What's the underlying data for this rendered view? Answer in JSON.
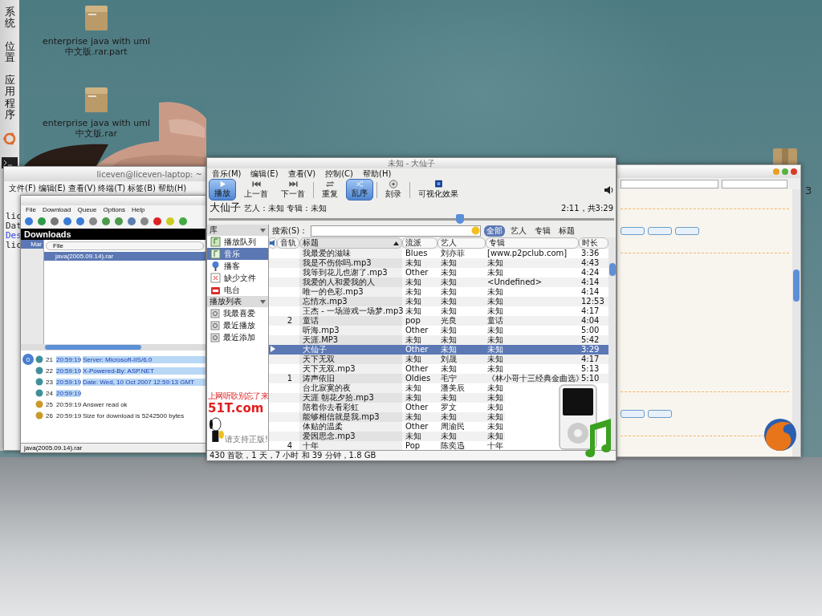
{
  "panel_menus": [
    {
      "label": "系统"
    },
    {
      "label": "位置"
    },
    {
      "label": "应用程序"
    }
  ],
  "desktop_icons": [
    {
      "label": "enterprise java with uml中文版.rar.part"
    },
    {
      "label": "enterprise java with uml中文版.rar"
    }
  ],
  "desktop_edge_label": "3",
  "terminal_window": {
    "title": "liceven@liceven-laptop: ~",
    "menu": [
      "文件(F)",
      "编辑(E)",
      "查看(V)",
      "终端(T)",
      "标签(B)",
      "帮助(H)"
    ],
    "lines": [
      {
        "text": "lic",
        "kind": "plain"
      },
      {
        "text": "Dat",
        "kind": "plain"
      },
      {
        "text": "Des",
        "kind": "directory"
      },
      {
        "text": "lic",
        "kind": "plain"
      }
    ]
  },
  "downloader_window": {
    "menu": [
      "File",
      "Download",
      "Queue",
      "Options",
      "Help"
    ],
    "panel_title": "Downloads",
    "tree_item": "Mar",
    "columns": [
      "File"
    ],
    "files": [
      {
        "name": "java(2005.09.14).rar",
        "selected": true
      }
    ],
    "log_badge": "0",
    "log": [
      {
        "number": "21",
        "time": "20:59:19",
        "message": "Server: Microsoft-IIS/6.0",
        "highlighted": true
      },
      {
        "number": "22",
        "time": "20:59:19",
        "message": "X-Powered-By: ASP.NET",
        "highlighted": true
      },
      {
        "number": "23",
        "time": "20:59:19",
        "message": "Date: Wed, 10 Oct 2007 12:59:13 GMT",
        "highlighted": true
      },
      {
        "number": "24",
        "time": "20:59:19",
        "highlighted": true
      },
      {
        "number": "25",
        "time": "20:59:19",
        "message": "Answer read ok",
        "highlighted": false
      },
      {
        "number": "26",
        "time": "20:59:19",
        "message": "Size for download is 5242500 bytes",
        "highlighted": false
      }
    ],
    "status": "java(2005.09.14).rar"
  },
  "player": {
    "title": "未知 - 大仙子",
    "menu": [
      "音乐(M)",
      "编辑(E)",
      "查看(V)",
      "控制(C)",
      "帮助(H)"
    ],
    "toolbar": [
      {
        "label": "播放",
        "kind": "play",
        "selected": true
      },
      {
        "label": "上一首",
        "kind": "previous",
        "selected": false
      },
      {
        "label": "下一首",
        "kind": "next",
        "selected": false
      },
      {
        "label": "重复",
        "kind": "repeat",
        "selected": false
      },
      {
        "label": "乱序",
        "kind": "shuffle",
        "selected": true
      },
      {
        "label": "刻录",
        "kind": "burn",
        "selected": false
      },
      {
        "label": "可视化效果",
        "kind": "visual",
        "selected": false
      }
    ],
    "now_playing": {
      "title": "大仙子",
      "details": "艺人：未知 专辑：未知",
      "time": "2:11，共3:29"
    },
    "position": {
      "level": 0.62
    },
    "sidebar": {
      "library_header": "库",
      "library": [
        {
          "label": "播放队列",
          "kind": "queue",
          "selected": false
        },
        {
          "label": "音乐",
          "kind": "music",
          "selected": true
        },
        {
          "label": "播客",
          "kind": "podcast",
          "selected": false
        },
        {
          "label": "缺少文件",
          "kind": "missing",
          "selected": false
        },
        {
          "label": "电台",
          "kind": "radio",
          "selected": false
        }
      ],
      "playlists_header": "播放列表",
      "playlists": [
        {
          "label": "我最喜爱",
          "selected": false
        },
        {
          "label": "最近播放",
          "selected": false
        },
        {
          "label": "最近添加",
          "selected": false
        }
      ],
      "ad": {
        "slogan": "上网听歌别忘了来",
        "brand": "51T.com",
        "note": "请支持正版!"
      }
    },
    "search": {
      "label": "搜索(S)：",
      "filters": [
        {
          "label": "全部",
          "selected": true
        },
        {
          "label": "艺人",
          "selected": false
        },
        {
          "label": "专辑",
          "selected": false
        },
        {
          "label": "标题",
          "selected": false
        }
      ]
    },
    "columns": [
      {
        "label": "音轨",
        "sorted": false
      },
      {
        "label": "标题",
        "sorted": true
      },
      {
        "label": "流派",
        "sorted": false
      },
      {
        "label": "艺人",
        "sorted": false
      },
      {
        "label": "专辑",
        "sorted": false
      },
      {
        "label": "时长",
        "sorted": false
      }
    ],
    "rows": [
      {
        "title": "我最爱的滋味",
        "genre": "Blues",
        "artist": "刘亦菲",
        "album": "[www.p2pclub.com]",
        "duration": "3:36",
        "selected": false,
        "playing": false
      },
      {
        "title": "我是不伤你吗.mp3",
        "genre": "未知",
        "artist": "未知",
        "album": "未知",
        "duration": "4:43",
        "selected": false,
        "playing": false
      },
      {
        "title": "我等到花儿也谢了.mp3",
        "genre": "Other",
        "artist": "未知",
        "album": "未知",
        "duration": "4:24",
        "selected": false,
        "playing": false
      },
      {
        "title": "我爱的人和爱我的人",
        "genre": "未知",
        "artist": "未知",
        "album": "<Undefined>",
        "duration": "4:14",
        "selected": false,
        "playing": false
      },
      {
        "title": "唯一的色彩.mp3",
        "genre": "未知",
        "artist": "未知",
        "album": "未知",
        "duration": "4:14",
        "selected": false,
        "playing": false
      },
      {
        "title": "忘情水.mp3",
        "genre": "未知",
        "artist": "未知",
        "album": "未知",
        "duration": "12:53",
        "selected": false,
        "playing": false
      },
      {
        "title": "王杰 - 一场游戏一场梦.mp3",
        "genre": "未知",
        "artist": "未知",
        "album": "未知",
        "duration": "4:17",
        "selected": false,
        "playing": false
      },
      {
        "track": "2",
        "title": "童话",
        "genre": "pop",
        "artist": "光良",
        "album": "童话",
        "duration": "4:04",
        "selected": false,
        "playing": false
      },
      {
        "title": "听海.mp3",
        "genre": "Other",
        "artist": "未知",
        "album": "未知",
        "duration": "5:00",
        "selected": false,
        "playing": false
      },
      {
        "title": "天涯.MP3",
        "genre": "未知",
        "artist": "未知",
        "album": "未知",
        "duration": "5:42",
        "selected": false,
        "playing": false
      },
      {
        "title": "大仙子",
        "genre": "Other",
        "artist": "未知",
        "album": "未知",
        "duration": "3:29",
        "selected": true,
        "playing": true
      },
      {
        "title": "天下无双",
        "genre": "未知",
        "artist": "刘晟",
        "album": "未知",
        "duration": "4:17",
        "selected": false,
        "playing": false
      },
      {
        "title": "天下无双.mp3",
        "genre": "Other",
        "artist": "未知",
        "album": "未知",
        "duration": "5:13",
        "selected": false,
        "playing": false
      },
      {
        "track": "1",
        "title": "涛声依旧",
        "genre": "Oldies",
        "artist": "毛宁",
        "album": "《林小哥十三经典金曲选》",
        "duration": "5:10",
        "selected": false,
        "playing": false
      },
      {
        "title": "台北寂寞的夜",
        "genre": "未知",
        "artist": "潘美辰",
        "album": "未知",
        "selected": false,
        "playing": false
      },
      {
        "title": "天涯 朝花夕拾.mp3",
        "genre": "未知",
        "artist": "未知",
        "album": "未知",
        "selected": false,
        "playing": false
      },
      {
        "title": "陪着你去看彩虹",
        "genre": "Other",
        "artist": "罗文",
        "album": "未知",
        "selected": false,
        "playing": false
      },
      {
        "title": "能够相信就是我.mp3",
        "genre": "未知",
        "artist": "未知",
        "album": "未知",
        "selected": false,
        "playing": false
      },
      {
        "title": "体贴的温柔",
        "genre": "Other",
        "artist": "周渝民",
        "album": "未知",
        "selected": false,
        "playing": false
      },
      {
        "title": "爱因思念.mp3",
        "genre": "未知",
        "artist": "未知",
        "album": "未知",
        "selected": false,
        "playing": false
      },
      {
        "track": "4",
        "title": "十年",
        "genre": "Pop",
        "artist": "陈奕迅",
        "album": "十年",
        "selected": false,
        "playing": false
      }
    ],
    "status": "430 首歌，1 天，7 小时 和 39 分钟，1.8 GB"
  }
}
